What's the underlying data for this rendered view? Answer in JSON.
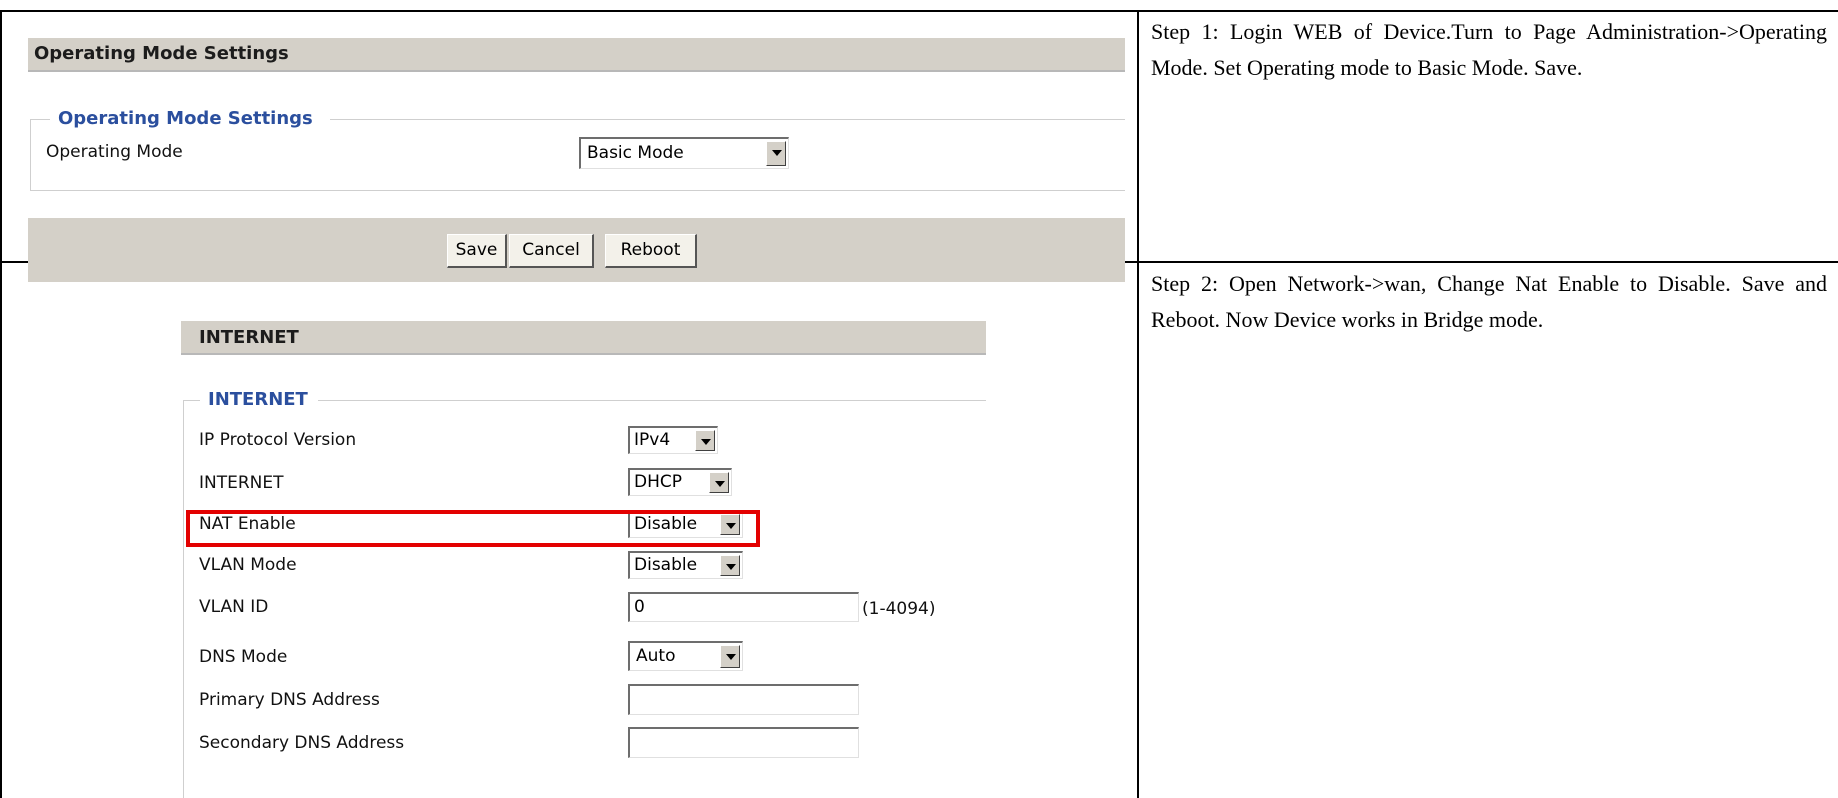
{
  "step1": {
    "panel_title": "Operating Mode Settings",
    "fieldset_legend": "Operating Mode Settings",
    "operating_mode_label": "Operating Mode",
    "operating_mode_value": "Basic Mode",
    "buttons": {
      "save": "Save",
      "cancel": "Cancel",
      "reboot": "Reboot"
    },
    "instruction": "Step 1: Login WEB of Device.Turn to Page Administration->Operating Mode. Set Operating mode to Basic Mode. Save."
  },
  "step2": {
    "panel_title": "INTERNET",
    "fieldset_legend": "INTERNET",
    "fields": {
      "ip_protocol": {
        "label": "IP Protocol Version",
        "value": "IPv4"
      },
      "internet": {
        "label": "INTERNET",
        "value": "DHCP"
      },
      "nat_enable": {
        "label": "NAT Enable",
        "value": "Disable"
      },
      "vlan_mode": {
        "label": "VLAN Mode",
        "value": "Disable"
      },
      "vlan_id": {
        "label": "VLAN ID",
        "value": "0",
        "range_hint": "(1-4094)"
      },
      "dns_mode": {
        "label": "DNS Mode",
        "value": "Auto"
      },
      "primary_dns": {
        "label": "Primary DNS Address",
        "value": ""
      },
      "secondary_dns": {
        "label": "Secondary DNS Address",
        "value": ""
      }
    },
    "instruction": "Step 2: Open Network->wan, Change Nat Enable to Disable. Save and Reboot. Now Device works in Bridge mode."
  },
  "colors": {
    "highlight": "#e30000",
    "legend": "#2b4f9e",
    "panel_bg": "#d4d0c8"
  }
}
